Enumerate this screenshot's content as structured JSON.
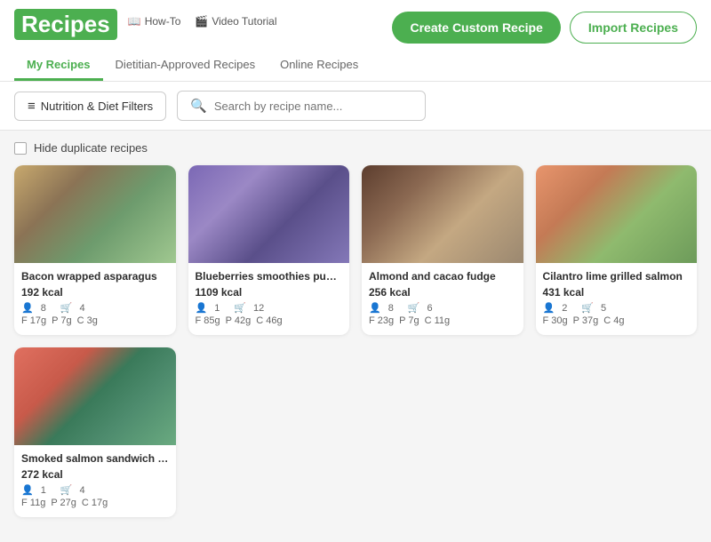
{
  "header": {
    "title": "Recipes",
    "help_links": [
      {
        "label": "How-To",
        "icon": "book-icon"
      },
      {
        "label": "Video Tutorial",
        "icon": "video-icon"
      }
    ],
    "buttons": {
      "create": "Create Custom Recipe",
      "import": "Import Recipes"
    }
  },
  "tabs": [
    {
      "label": "My Recipes",
      "active": true
    },
    {
      "label": "Dietitian-Approved Recipes",
      "active": false
    },
    {
      "label": "Online Recipes",
      "active": false
    }
  ],
  "toolbar": {
    "filter_label": "Nutrition & Diet Filters",
    "search_placeholder": "Search by recipe name...",
    "search_label": "Search recipe"
  },
  "hide_duplicates": {
    "label": "Hide duplicate recipes"
  },
  "recipes": [
    {
      "name": "Bacon wrapped asparagus",
      "kcal": "192 kcal",
      "servings": "8",
      "cart": "4",
      "fat": "F 17g",
      "protein": "P 7g",
      "carbs": "C 3g",
      "img_class": "img-bacon"
    },
    {
      "name": "Blueberries smoothies pudding (c...",
      "kcal": "1109 kcal",
      "servings": "1",
      "cart": "12",
      "fat": "F 85g",
      "protein": "P 42g",
      "carbs": "C 46g",
      "img_class": "img-blueberry"
    },
    {
      "name": "Almond and cacao fudge",
      "kcal": "256 kcal",
      "servings": "8",
      "cart": "6",
      "fat": "F 23g",
      "protein": "P 7g",
      "carbs": "C 11g",
      "img_class": "img-almond"
    },
    {
      "name": "Cilantro lime grilled salmon",
      "kcal": "431 kcal",
      "servings": "2",
      "cart": "5",
      "fat": "F 30g",
      "protein": "P 37g",
      "carbs": "C 4g",
      "img_class": "img-salmon"
    },
    {
      "name": "Smoked salmon sandwich with cu...",
      "kcal": "272 kcal",
      "servings": "1",
      "cart": "4",
      "fat": "F 11g",
      "protein": "P 27g",
      "carbs": "C 17g",
      "img_class": "img-sandwich"
    }
  ]
}
